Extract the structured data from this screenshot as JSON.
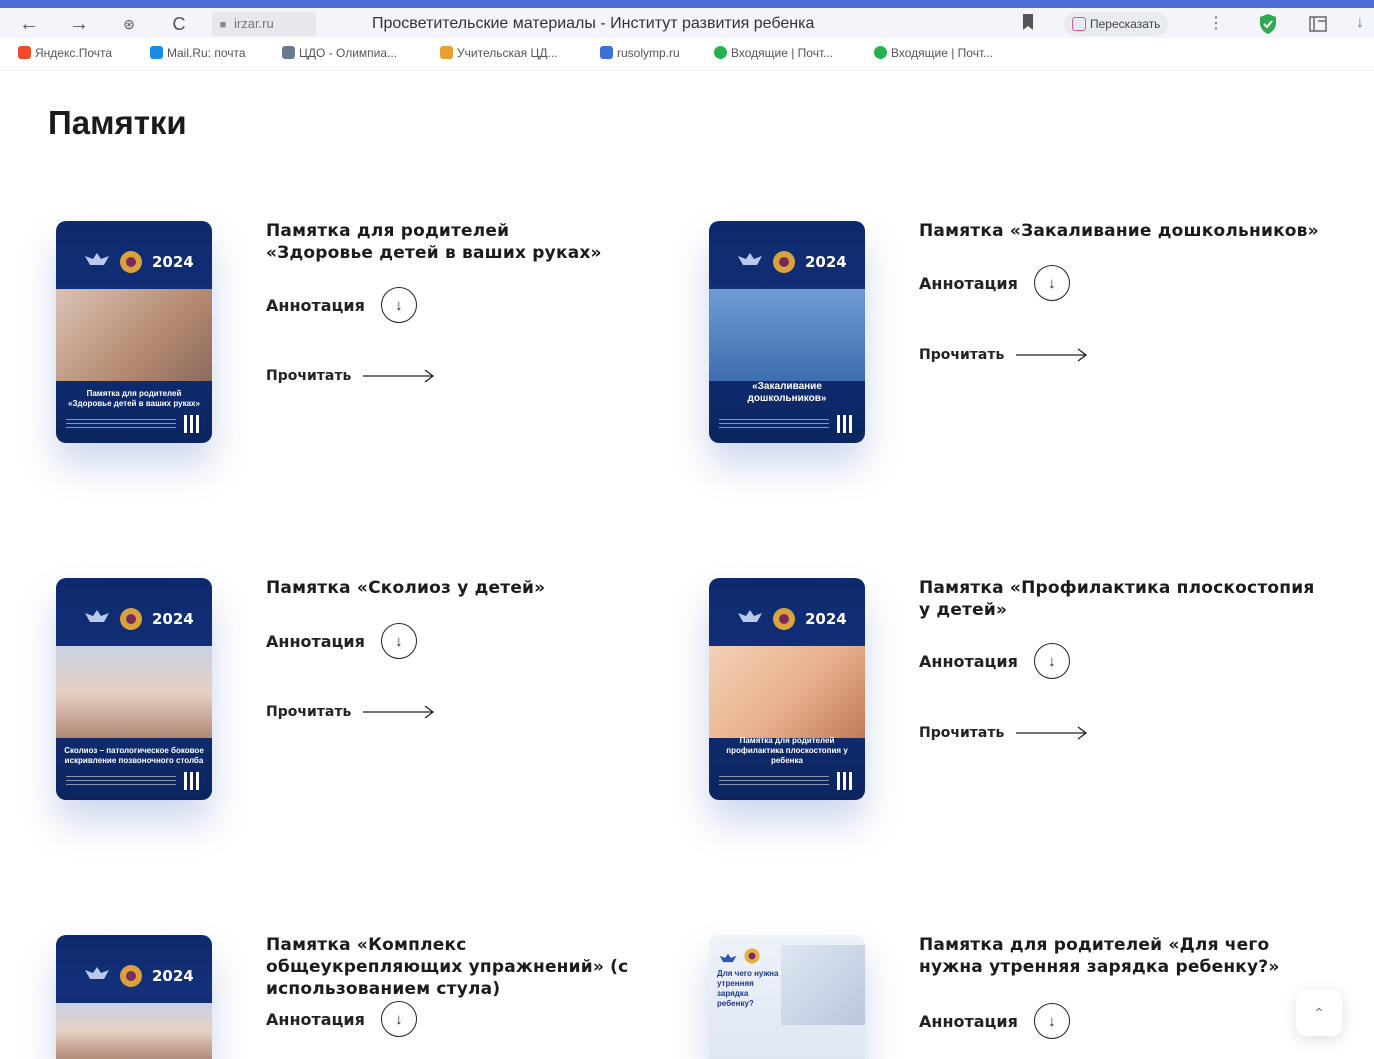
{
  "browser": {
    "url": "irzar.ru",
    "tab_title": "Просветительские материалы - Институт развития ребенка",
    "retell_label": "Пересказать",
    "nav": {
      "back": "←",
      "forward": "→",
      "reload": "C"
    }
  },
  "bookmarks": [
    {
      "label": "Яндекс.Почта",
      "color": "#f04a2c"
    },
    {
      "label": "Mail.Ru: почта",
      "color": "#168de2"
    },
    {
      "label": "ЦДО - Олимпиа...",
      "color": "#6b7b8c"
    },
    {
      "label": "Учительская ЦД...",
      "color": "#e8a033"
    },
    {
      "label": "rusolymp.ru",
      "color": "#3c6fd8"
    },
    {
      "label": "Входящие | Почт...",
      "color": "#27b14f"
    },
    {
      "label": "Входящие | Почт...",
      "color": "#27b14f"
    }
  ],
  "page": {
    "heading": "Памятки",
    "annotation_label": "Аннотация",
    "read_label": "Прочитать",
    "year_badge": "2024",
    "items": [
      {
        "title": "Памятка для родителей «Здоровье детей в ваших руках»",
        "cover_caption": "Памятка для родителей «Здоровье детей в ваших руках»",
        "has_read": true
      },
      {
        "title": "Памятка «Закаливание дошкольников»",
        "cover_caption": "«Закаливание дошкольников»",
        "has_read": true
      },
      {
        "title": "Памятка «Сколиоз у детей»",
        "cover_caption": "Сколиоз – патологическое боковое искривление позвоночного столба",
        "has_read": true
      },
      {
        "title": "Памятка «Профилактика плоскостопия у детей»",
        "cover_caption": "Памятка для родителей профилактика плоскостопия у ребенка",
        "has_read": true
      },
      {
        "title": "Памятка «Комплекс общеукрепляющих упражнений» (с использованием стула)",
        "cover_caption": "",
        "has_read": false
      },
      {
        "title": "Памятка для родителей «Для чего нужна утренняя зарядка ребенку?»",
        "cover_caption": "Для чего нужна утренняя зарядка ребенку?",
        "has_read": false
      }
    ]
  }
}
